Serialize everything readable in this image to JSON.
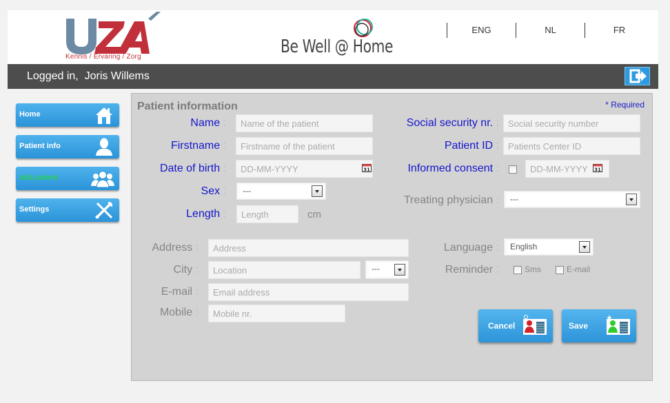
{
  "header": {
    "uza_logo_text": "UZA",
    "uza_tagline": "Kennis / Ervaring / Zorg",
    "app_logo_text": "Be Well @ Home",
    "languages": [
      "ENG",
      "NL",
      "FR"
    ]
  },
  "userbar": {
    "logged_in_text": "Logged in,  Joris Willems",
    "logout_icon": "logout-icon"
  },
  "sidebar": {
    "items": [
      {
        "label": "Home",
        "icon": "home-icon"
      },
      {
        "label": "Patient info",
        "icon": "user-icon"
      },
      {
        "label": "Add patient",
        "icon": "users-icon",
        "label_color": "#22dd22"
      },
      {
        "label": "Settings",
        "icon": "tools-icon"
      }
    ]
  },
  "form": {
    "title": "Patient information",
    "required_note": "* Required",
    "name": {
      "label": "Name",
      "placeholder": "Name of the patient",
      "value": ""
    },
    "firstname": {
      "label": "Firstname",
      "placeholder": "Firstname of the patient",
      "value": ""
    },
    "date_of_birth": {
      "label": "Date of birth",
      "placeholder": "DD-MM-YYYY",
      "value": ""
    },
    "sex": {
      "label": "Sex",
      "selected": "---"
    },
    "length": {
      "label": "Length",
      "placeholder": "Length",
      "unit": "cm"
    },
    "social_security": {
      "label": "Social security nr.",
      "placeholder": "Social security number"
    },
    "patient_id": {
      "label": "Patient ID",
      "placeholder": "Patients Center ID"
    },
    "informed_consent": {
      "label": "Informed consent",
      "checked": false,
      "date_placeholder": "DD-MM-YYYY"
    },
    "treating_physician": {
      "label": "Treating physician",
      "selected": "---"
    },
    "address": {
      "label": "Address",
      "placeholder": "Address"
    },
    "city": {
      "label": "City",
      "placeholder": "Location",
      "selected": "---"
    },
    "email": {
      "label": "E-mail",
      "placeholder": "Email address"
    },
    "mobile": {
      "label": "Mobile",
      "placeholder": "Mobile nr."
    },
    "language": {
      "label": "Language",
      "selected": "English"
    },
    "reminder": {
      "label": "Reminder",
      "options": [
        {
          "label": "Sms",
          "checked": false
        },
        {
          "label": "E-mail",
          "checked": false
        }
      ]
    },
    "colon": ":",
    "cancel_label": "Cancel",
    "save_label": "Save"
  },
  "colors": {
    "accent_blue": "#2e9ae0",
    "label_blue": "#1515cc",
    "uza_red": "#c1303a",
    "uza_grey_blue": "#6c8aa3"
  }
}
